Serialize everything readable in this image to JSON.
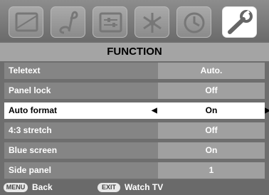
{
  "tabs": [
    {
      "name": "picture",
      "icon": "screen-icon"
    },
    {
      "name": "sound",
      "icon": "music-note-icon"
    },
    {
      "name": "settings",
      "icon": "sliders-icon"
    },
    {
      "name": "tuning",
      "icon": "antenna-icon"
    },
    {
      "name": "timer",
      "icon": "clock-icon"
    },
    {
      "name": "function",
      "icon": "wrench-icon",
      "active": true
    }
  ],
  "menu": {
    "title": "FUNCTION",
    "rows": [
      {
        "label": "Teletext",
        "value": "Auto."
      },
      {
        "label": "Panel lock",
        "value": "Off"
      },
      {
        "label": "Auto format",
        "value": "On",
        "selected": true
      },
      {
        "label": "4:3 stretch",
        "value": "Off"
      },
      {
        "label": "Blue screen",
        "value": "On"
      },
      {
        "label": "Side panel",
        "value": "1"
      }
    ]
  },
  "footer": {
    "menu_key": "MENU",
    "menu_label": "Back",
    "exit_key": "EXIT",
    "exit_label": "Watch TV"
  },
  "colors": {
    "background": "#6e6e6e",
    "label_bg": "#858585",
    "value_bg": "#a0a0a0",
    "selected_bg": "#ffffff"
  }
}
